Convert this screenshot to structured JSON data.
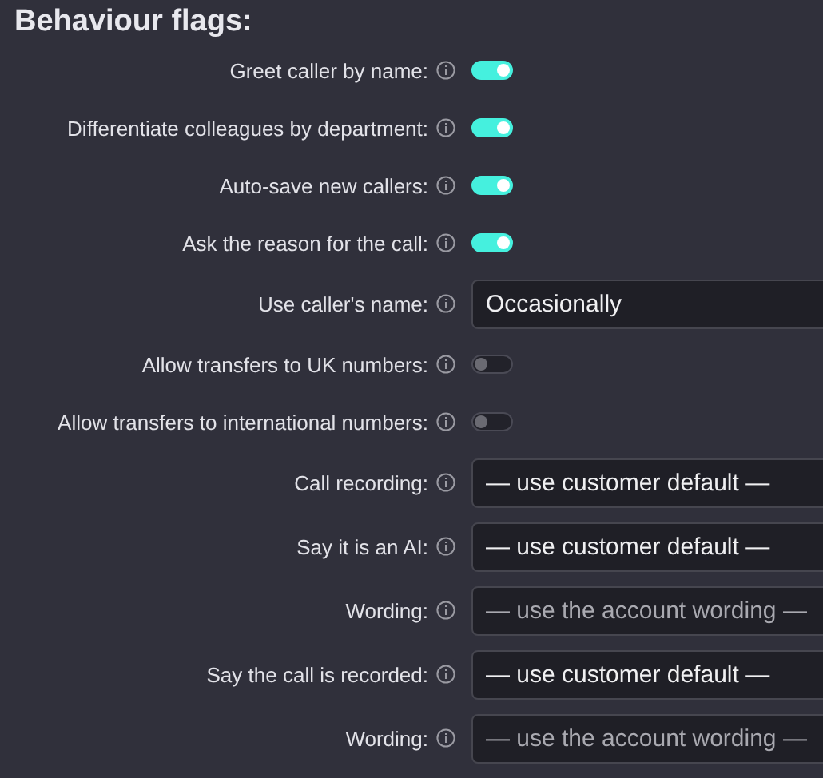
{
  "title": "Behaviour flags:",
  "rows": [
    {
      "kind": "toggle",
      "label": "Greet caller by name:",
      "on": true
    },
    {
      "kind": "toggle",
      "label": "Differentiate colleagues by department:",
      "on": true
    },
    {
      "kind": "toggle",
      "label": "Auto-save new callers:",
      "on": true
    },
    {
      "kind": "toggle",
      "label": "Ask the reason for the call:",
      "on": true
    },
    {
      "kind": "select",
      "label": "Use caller's name:",
      "value": "Occasionally"
    },
    {
      "kind": "toggle",
      "label": "Allow transfers to UK numbers:",
      "on": false
    },
    {
      "kind": "toggle",
      "label": "Allow transfers to international numbers:",
      "on": false
    },
    {
      "kind": "select",
      "label": "Call recording:",
      "value": "— use customer default —"
    },
    {
      "kind": "select",
      "label": "Say it is an AI:",
      "value": "— use customer default —"
    },
    {
      "kind": "input",
      "label": "Wording:",
      "placeholder": "— use the account wording —"
    },
    {
      "kind": "select",
      "label": "Say the call is recorded:",
      "value": "— use customer default —"
    },
    {
      "kind": "input",
      "label": "Wording:",
      "placeholder": "— use the account wording —"
    }
  ]
}
